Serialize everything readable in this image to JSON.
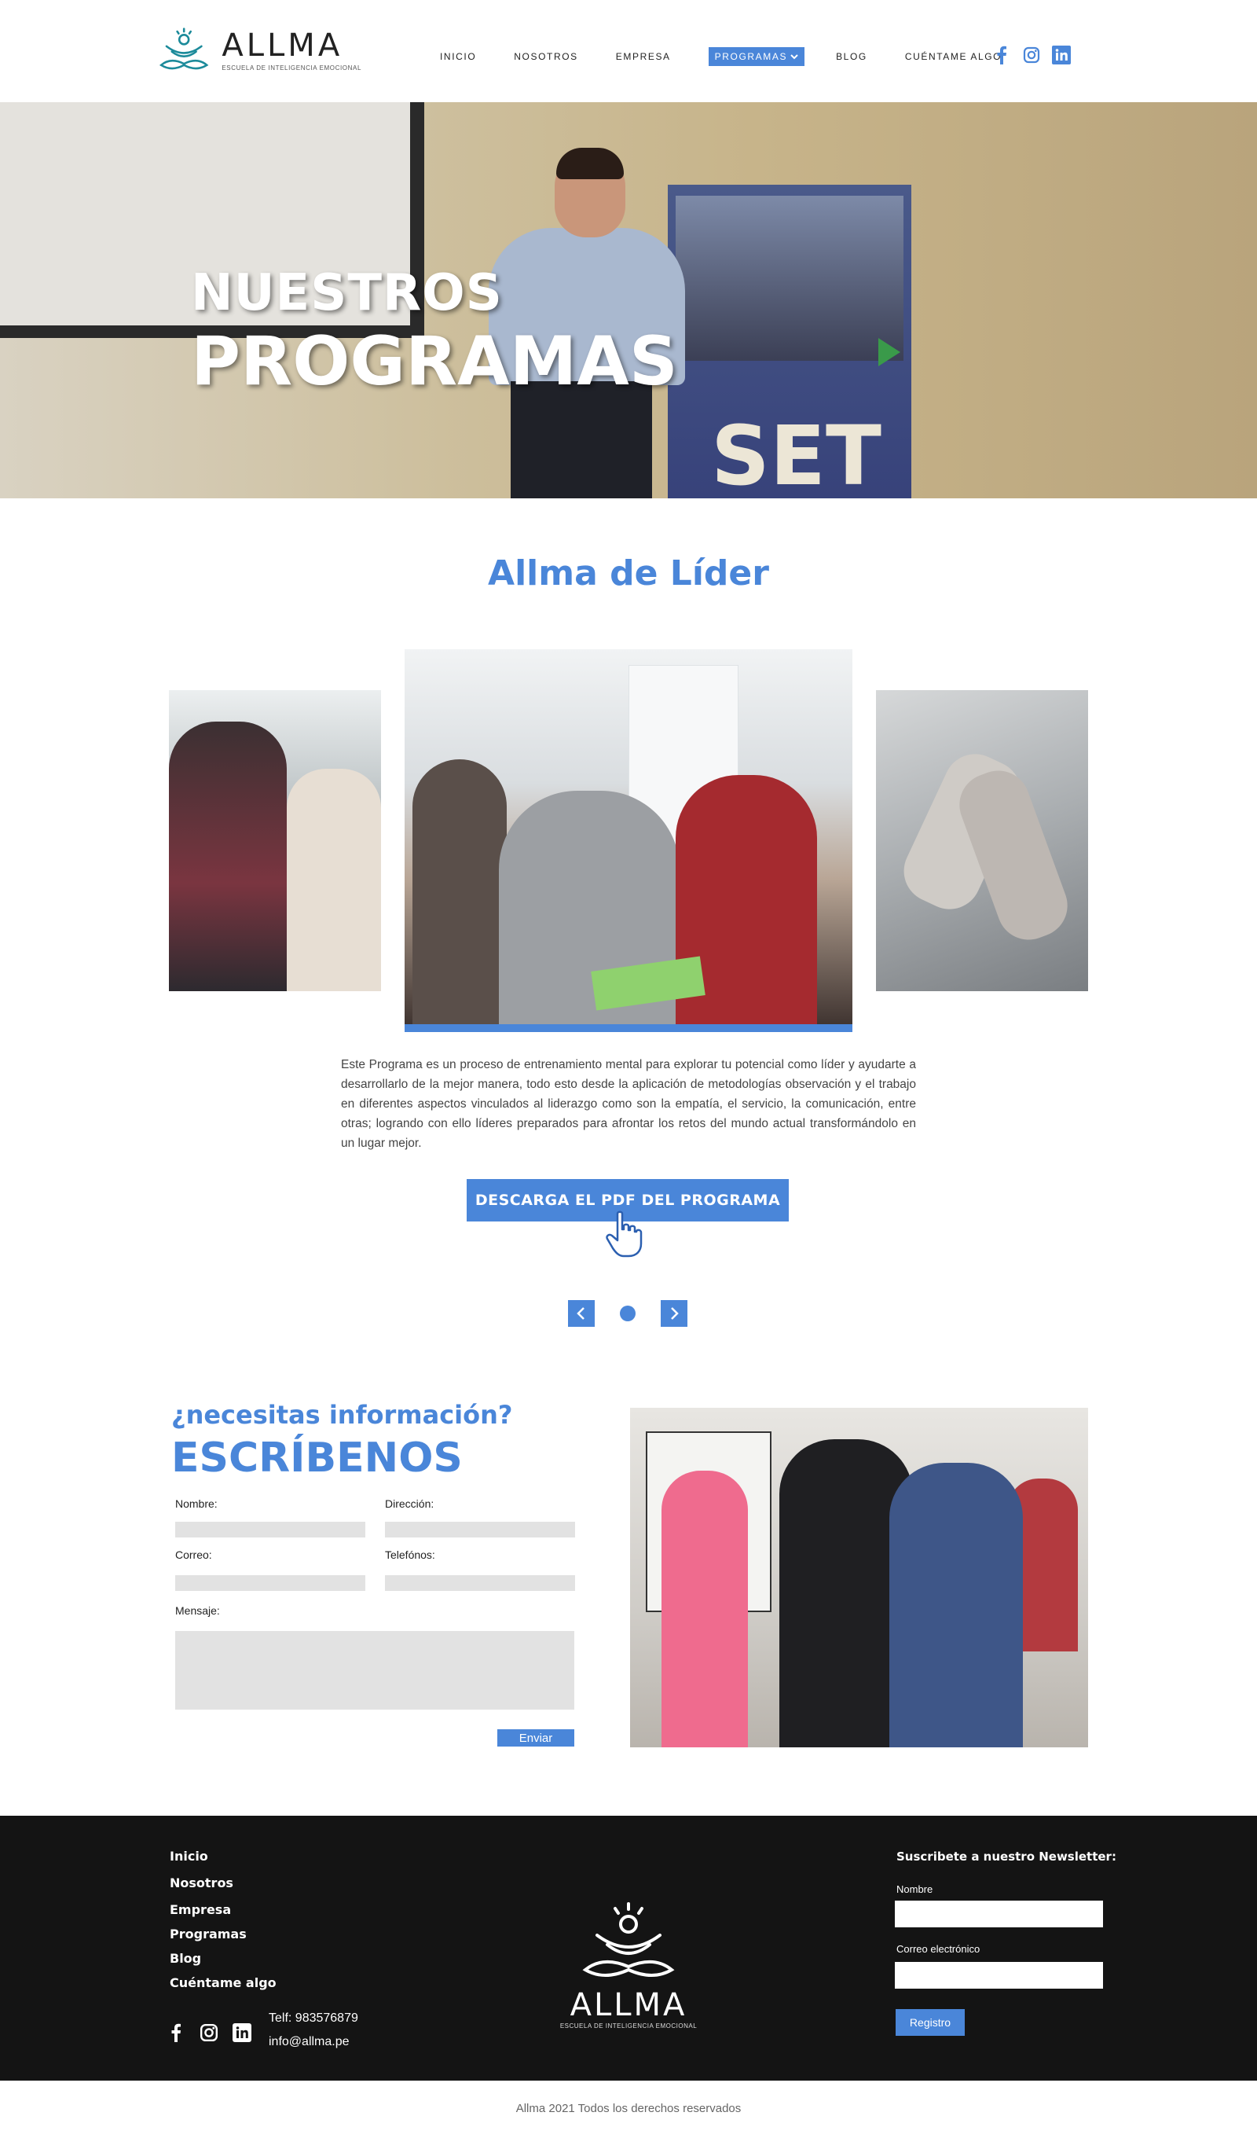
{
  "header": {
    "logo_name": "ALLMA",
    "logo_tagline": "ESCUELA DE INTELIGENCIA EMOCIONAL",
    "nav": [
      {
        "label": "INICIO"
      },
      {
        "label": "NOSOTROS"
      },
      {
        "label": "EMPRESA"
      },
      {
        "label": "PROGRAMAS"
      },
      {
        "label": "BLOG"
      },
      {
        "label": "CUÉNTAME ALGO"
      }
    ],
    "active_nav": "PROGRAMAS",
    "social": [
      "facebook-icon",
      "instagram-icon",
      "linkedin-icon"
    ]
  },
  "hero": {
    "title_line1": "NUESTROS",
    "title_line2": "PROGRAMAS",
    "banner_text": "SET"
  },
  "program": {
    "title": "Allma de Líder",
    "description": "Este Programa es un proceso de entrenamiento mental para explorar tu potencial como líder y ayudarte a desarrollarlo de la mejor manera, todo esto desde la aplicación de metodologías observación y el trabajo en diferentes aspectos vinculados al liderazgo como son la empatía, el servicio, la comunicación, entre otras; logrando con ello líderes preparados para afrontar los retos del mundo actual transformándolo en un lugar mejor.",
    "cta_label": "DESCARGA EL PDF DEL PROGRAMA",
    "carousel_prev": "‹",
    "carousel_next": "›"
  },
  "contact": {
    "subtitle": "¿necesitas información?",
    "title": "ESCRÍBENOS",
    "fields": {
      "nombre": "Nombre:",
      "direccion": "Dirección:",
      "correo": "Correo:",
      "telefonos": "Telefónos:",
      "mensaje": "Mensaje:"
    },
    "submit_label": "Enviar"
  },
  "footer": {
    "links": [
      "Inicio",
      "Nosotros",
      "Empresa",
      "Programas",
      "Blog",
      "Cuéntame algo"
    ],
    "phone": "Telf: 983576879",
    "email": "info@allma.pe",
    "logo_name": "ALLMA",
    "logo_tagline": "ESCUELA DE INTELIGENCIA EMOCIONAL",
    "newsletter_title": "Suscribete a nuestro Newsletter:",
    "newsletter_name_label": "Nombre",
    "newsletter_email_label": "Correo electrónico",
    "newsletter_button": "Registro",
    "social": [
      "facebook-icon",
      "instagram-icon",
      "linkedin-icon"
    ]
  },
  "copyright": "Allma 2021 Todos los derechos reservados",
  "colors": {
    "accent": "#4a86d9",
    "footer_bg": "#141414",
    "logo_teal": "#1b8a9a"
  }
}
